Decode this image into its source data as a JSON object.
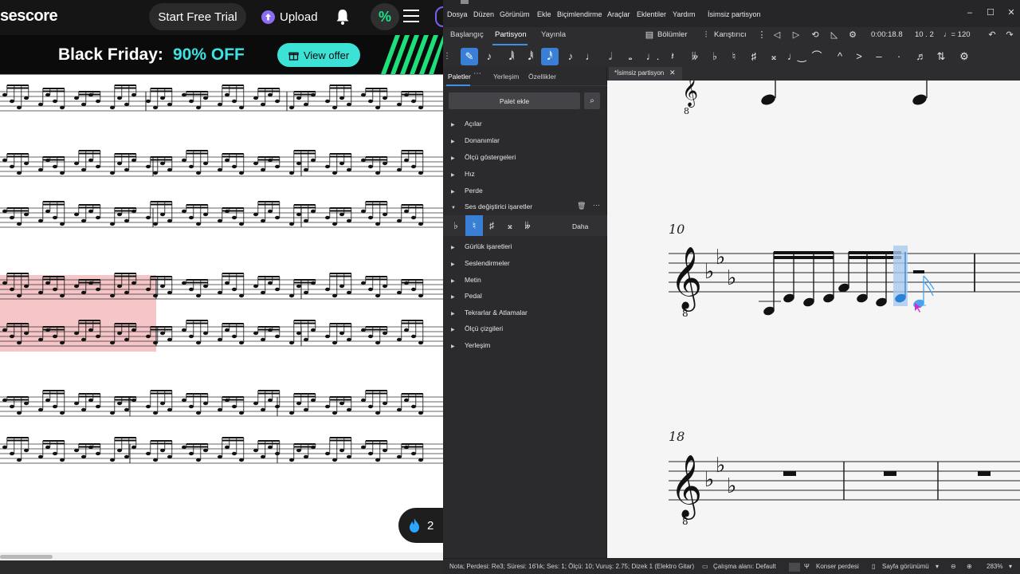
{
  "browser": {
    "logo_text": "sescore",
    "start_trial_label": "Start Free Trial",
    "upload_label": "Upload",
    "promo": {
      "title": "Black Friday:",
      "discount": "90% OFF",
      "cta": "View offer"
    },
    "fire_count": "2"
  },
  "app": {
    "menu": [
      "Dosya",
      "Düzen",
      "Görünüm",
      "Ekle",
      "Biçimlendirme",
      "Araçlar",
      "Eklentiler",
      "Yardım"
    ],
    "window_title": "İsimsiz partisyon",
    "workspace_tabs": {
      "home": "Başlangıç",
      "score": "Partisyon",
      "publish": "Yayınla"
    },
    "toolbar": {
      "parts": "Bölümler",
      "mixer": "Karıştırıcı",
      "time": "0:00:18.8",
      "position": "10 . 2",
      "tempo": "♩= 120"
    },
    "panel": {
      "tabs": [
        "Paletler",
        "Yerleşim",
        "Özellikler"
      ],
      "add_palette": "Palet ekle",
      "palettes": [
        "Açılar",
        "Donanımlar",
        "Ölçü göstergeleri",
        "Hız",
        "Perde",
        "Ses değiştirici işaretler",
        "Gürlük işaretleri",
        "Seslendirmeler",
        "Metin",
        "Pedal",
        "Tekrarlar & Atlamalar",
        "Ölçü çizgileri",
        "Yerleşim"
      ],
      "accidentals": [
        "♭",
        "♮",
        "♯",
        "𝄪",
        "𝄫"
      ],
      "more": "Daha"
    },
    "document_tab": "*İsimsiz partisyon",
    "score": {
      "measure_10": "10",
      "measure_18": "18"
    },
    "status": {
      "selection": "Nota; Perdesi: Re3; Süresi: 16'lık; Ses: 1; Ölçü: 10; Vuruş: 2.75; Dizek 1 (Elektro Gitar)",
      "workspace": "Çalışma alanı: Default",
      "concert_pitch": "Konser perdesi",
      "page_view": "Sayfa görünümü",
      "zoom": "283%"
    },
    "accent_color": "#3a7fd6"
  }
}
